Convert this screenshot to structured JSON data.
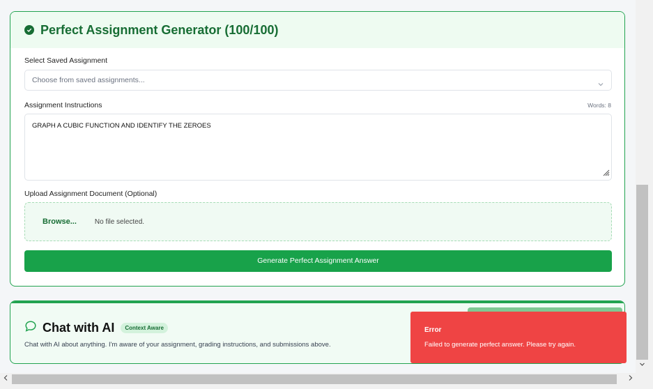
{
  "generator": {
    "title": "Perfect Assignment Generator (100/100)",
    "select_label": "Select Saved Assignment",
    "select_placeholder": "Choose from saved assignments...",
    "instructions_label": "Assignment Instructions",
    "word_count": "Words: 8",
    "instructions_value": "GRAPH A CUBIC FUNCTION AND IDENTIFY THE ZEROES",
    "upload_label": "Upload Assignment Document (Optional)",
    "browse_label": "Browse...",
    "file_status": "No file selected.",
    "generate_button": "Generate Perfect Assignment Answer"
  },
  "chat": {
    "title": "Chat with AI",
    "badge": "Context Aware",
    "description": "Chat with AI about anything. I'm aware of your assignment, grading instructions, and submissions above."
  },
  "toast": {
    "title": "Error",
    "message": "Failed to generate perfect answer. Please try again."
  },
  "colors": {
    "accent": "#18a24a",
    "accent_dark": "#176d34",
    "error": "#ef4444"
  },
  "icons": {
    "generator": "check-circle-icon",
    "chat": "chat-bubble-icon",
    "select": "chevron-down-icon"
  }
}
